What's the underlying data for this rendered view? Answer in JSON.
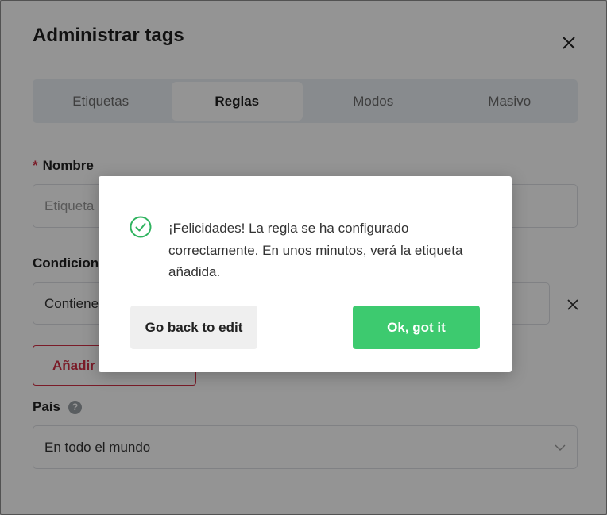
{
  "dialog": {
    "title": "Administrar tags",
    "tabs": [
      {
        "label": "Etiquetas",
        "active": false
      },
      {
        "label": "Reglas",
        "active": true
      },
      {
        "label": "Modos",
        "active": false
      },
      {
        "label": "Masivo",
        "active": false
      }
    ],
    "name_field": {
      "required_mark": "*",
      "label": "Nombre",
      "placeholder": "Etiqueta"
    },
    "conditions": {
      "label": "Condiciones",
      "value": "Contiene"
    },
    "add_button_label": "Añadir",
    "country": {
      "label": "País",
      "help_icon": "?",
      "value": "En todo el mundo"
    }
  },
  "modal": {
    "message": "¡Felicidades! La regla se ha configurado correctamente. En unos minutos, verá la etiqueta añadida.",
    "back_label": "Go back to edit",
    "ok_label": "Ok, got it"
  },
  "colors": {
    "accent_green": "#3dca6f",
    "accent_red": "#d32f45",
    "overlay": "rgba(0,0,0,0.42)"
  }
}
